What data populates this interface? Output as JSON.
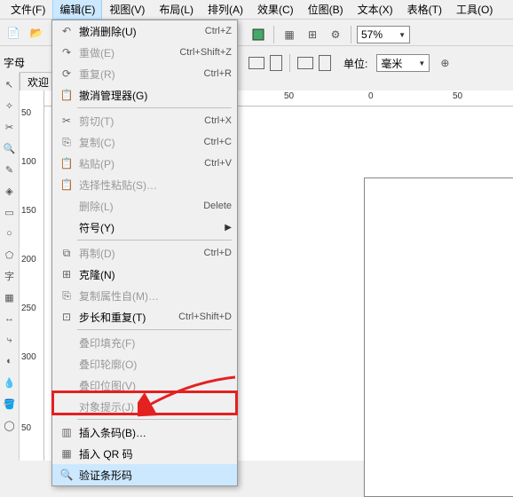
{
  "menubar": {
    "items": [
      {
        "label": "文件(F)"
      },
      {
        "label": "编辑(E)"
      },
      {
        "label": "视图(V)"
      },
      {
        "label": "布局(L)"
      },
      {
        "label": "排列(A)"
      },
      {
        "label": "效果(C)"
      },
      {
        "label": "位图(B)"
      },
      {
        "label": "文本(X)"
      },
      {
        "label": "表格(T)"
      },
      {
        "label": "工具(O)"
      }
    ],
    "active_index": 1
  },
  "toolbar": {
    "zoom_value": "57%",
    "unit_label": "单位:",
    "unit_value": "毫米"
  },
  "left_panel_label": "字母",
  "tabs": {
    "welcome": "欢迎"
  },
  "ruler_v_ticks": [
    "50",
    "100",
    "150",
    "200",
    "250",
    "300",
    "50"
  ],
  "ruler_h_ticks": [
    "50",
    "0",
    "50"
  ],
  "edit_menu": {
    "items": [
      {
        "icon": "undo",
        "label": "撤消删除(U)",
        "shortcut": "Ctrl+Z",
        "enabled": true
      },
      {
        "icon": "redo",
        "label": "重做(E)",
        "shortcut": "Ctrl+Shift+Z",
        "enabled": false
      },
      {
        "icon": "repeat",
        "label": "重复(R)",
        "shortcut": "Ctrl+R",
        "enabled": false
      },
      {
        "icon": "history",
        "label": "撤消管理器(G)",
        "shortcut": "",
        "enabled": true
      },
      {
        "sep": true
      },
      {
        "icon": "cut",
        "label": "剪切(T)",
        "shortcut": "Ctrl+X",
        "enabled": false
      },
      {
        "icon": "copy",
        "label": "复制(C)",
        "shortcut": "Ctrl+C",
        "enabled": false
      },
      {
        "icon": "paste",
        "label": "粘贴(P)",
        "shortcut": "Ctrl+V",
        "enabled": false
      },
      {
        "icon": "paste-special",
        "label": "选择性粘贴(S)…",
        "shortcut": "",
        "enabled": false
      },
      {
        "icon": "delete",
        "label": "删除(L)",
        "shortcut": "Delete",
        "enabled": false
      },
      {
        "icon": "",
        "label": "符号(Y)",
        "shortcut": "",
        "enabled": true,
        "submenu": true
      },
      {
        "sep": true
      },
      {
        "icon": "duplicate",
        "label": "再制(D)",
        "shortcut": "Ctrl+D",
        "enabled": false
      },
      {
        "icon": "clone",
        "label": "克隆(N)",
        "shortcut": "",
        "enabled": true
      },
      {
        "icon": "copy-props",
        "label": "复制属性自(M)…",
        "shortcut": "",
        "enabled": false
      },
      {
        "icon": "step",
        "label": "步长和重复(T)",
        "shortcut": "Ctrl+Shift+D",
        "enabled": true
      },
      {
        "sep": true
      },
      {
        "icon": "",
        "label": "叠印填充(F)",
        "shortcut": "",
        "enabled": false
      },
      {
        "icon": "",
        "label": "叠印轮廓(O)",
        "shortcut": "",
        "enabled": false
      },
      {
        "icon": "",
        "label": "叠印位图(V)",
        "shortcut": "",
        "enabled": false
      },
      {
        "icon": "",
        "label": "对象提示(J)",
        "shortcut": "",
        "enabled": false
      },
      {
        "sep": true
      },
      {
        "icon": "barcode",
        "label": "插入条码(B)…",
        "shortcut": "",
        "enabled": true,
        "highlighted": true
      },
      {
        "icon": "qr",
        "label": "插入 QR 码",
        "shortcut": "",
        "enabled": true
      },
      {
        "icon": "verify",
        "label": "验证条形码",
        "shortcut": "",
        "enabled": true,
        "hover": true
      }
    ]
  },
  "colors": {
    "highlight": "#e52020",
    "hover": "#cce8ff"
  }
}
